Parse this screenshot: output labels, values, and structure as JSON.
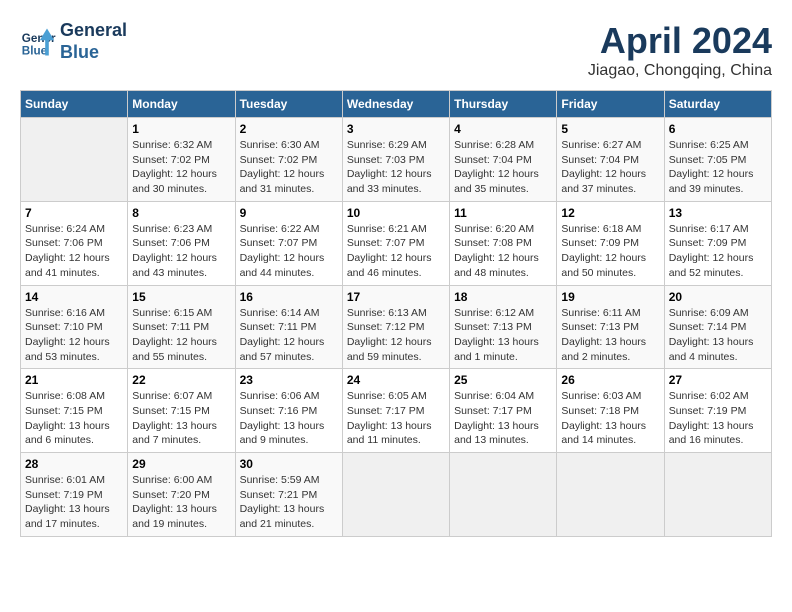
{
  "logo": {
    "line1": "General",
    "line2": "Blue"
  },
  "title": "April 2024",
  "location": "Jiagao, Chongqing, China",
  "weekdays": [
    "Sunday",
    "Monday",
    "Tuesday",
    "Wednesday",
    "Thursday",
    "Friday",
    "Saturday"
  ],
  "weeks": [
    [
      {
        "day": "",
        "info": ""
      },
      {
        "day": "1",
        "info": "Sunrise: 6:32 AM\nSunset: 7:02 PM\nDaylight: 12 hours\nand 30 minutes."
      },
      {
        "day": "2",
        "info": "Sunrise: 6:30 AM\nSunset: 7:02 PM\nDaylight: 12 hours\nand 31 minutes."
      },
      {
        "day": "3",
        "info": "Sunrise: 6:29 AM\nSunset: 7:03 PM\nDaylight: 12 hours\nand 33 minutes."
      },
      {
        "day": "4",
        "info": "Sunrise: 6:28 AM\nSunset: 7:04 PM\nDaylight: 12 hours\nand 35 minutes."
      },
      {
        "day": "5",
        "info": "Sunrise: 6:27 AM\nSunset: 7:04 PM\nDaylight: 12 hours\nand 37 minutes."
      },
      {
        "day": "6",
        "info": "Sunrise: 6:25 AM\nSunset: 7:05 PM\nDaylight: 12 hours\nand 39 minutes."
      }
    ],
    [
      {
        "day": "7",
        "info": "Sunrise: 6:24 AM\nSunset: 7:06 PM\nDaylight: 12 hours\nand 41 minutes."
      },
      {
        "day": "8",
        "info": "Sunrise: 6:23 AM\nSunset: 7:06 PM\nDaylight: 12 hours\nand 43 minutes."
      },
      {
        "day": "9",
        "info": "Sunrise: 6:22 AM\nSunset: 7:07 PM\nDaylight: 12 hours\nand 44 minutes."
      },
      {
        "day": "10",
        "info": "Sunrise: 6:21 AM\nSunset: 7:07 PM\nDaylight: 12 hours\nand 46 minutes."
      },
      {
        "day": "11",
        "info": "Sunrise: 6:20 AM\nSunset: 7:08 PM\nDaylight: 12 hours\nand 48 minutes."
      },
      {
        "day": "12",
        "info": "Sunrise: 6:18 AM\nSunset: 7:09 PM\nDaylight: 12 hours\nand 50 minutes."
      },
      {
        "day": "13",
        "info": "Sunrise: 6:17 AM\nSunset: 7:09 PM\nDaylight: 12 hours\nand 52 minutes."
      }
    ],
    [
      {
        "day": "14",
        "info": "Sunrise: 6:16 AM\nSunset: 7:10 PM\nDaylight: 12 hours\nand 53 minutes."
      },
      {
        "day": "15",
        "info": "Sunrise: 6:15 AM\nSunset: 7:11 PM\nDaylight: 12 hours\nand 55 minutes."
      },
      {
        "day": "16",
        "info": "Sunrise: 6:14 AM\nSunset: 7:11 PM\nDaylight: 12 hours\nand 57 minutes."
      },
      {
        "day": "17",
        "info": "Sunrise: 6:13 AM\nSunset: 7:12 PM\nDaylight: 12 hours\nand 59 minutes."
      },
      {
        "day": "18",
        "info": "Sunrise: 6:12 AM\nSunset: 7:13 PM\nDaylight: 13 hours\nand 1 minute."
      },
      {
        "day": "19",
        "info": "Sunrise: 6:11 AM\nSunset: 7:13 PM\nDaylight: 13 hours\nand 2 minutes."
      },
      {
        "day": "20",
        "info": "Sunrise: 6:09 AM\nSunset: 7:14 PM\nDaylight: 13 hours\nand 4 minutes."
      }
    ],
    [
      {
        "day": "21",
        "info": "Sunrise: 6:08 AM\nSunset: 7:15 PM\nDaylight: 13 hours\nand 6 minutes."
      },
      {
        "day": "22",
        "info": "Sunrise: 6:07 AM\nSunset: 7:15 PM\nDaylight: 13 hours\nand 7 minutes."
      },
      {
        "day": "23",
        "info": "Sunrise: 6:06 AM\nSunset: 7:16 PM\nDaylight: 13 hours\nand 9 minutes."
      },
      {
        "day": "24",
        "info": "Sunrise: 6:05 AM\nSunset: 7:17 PM\nDaylight: 13 hours\nand 11 minutes."
      },
      {
        "day": "25",
        "info": "Sunrise: 6:04 AM\nSunset: 7:17 PM\nDaylight: 13 hours\nand 13 minutes."
      },
      {
        "day": "26",
        "info": "Sunrise: 6:03 AM\nSunset: 7:18 PM\nDaylight: 13 hours\nand 14 minutes."
      },
      {
        "day": "27",
        "info": "Sunrise: 6:02 AM\nSunset: 7:19 PM\nDaylight: 13 hours\nand 16 minutes."
      }
    ],
    [
      {
        "day": "28",
        "info": "Sunrise: 6:01 AM\nSunset: 7:19 PM\nDaylight: 13 hours\nand 17 minutes."
      },
      {
        "day": "29",
        "info": "Sunrise: 6:00 AM\nSunset: 7:20 PM\nDaylight: 13 hours\nand 19 minutes."
      },
      {
        "day": "30",
        "info": "Sunrise: 5:59 AM\nSunset: 7:21 PM\nDaylight: 13 hours\nand 21 minutes."
      },
      {
        "day": "",
        "info": ""
      },
      {
        "day": "",
        "info": ""
      },
      {
        "day": "",
        "info": ""
      },
      {
        "day": "",
        "info": ""
      }
    ]
  ]
}
